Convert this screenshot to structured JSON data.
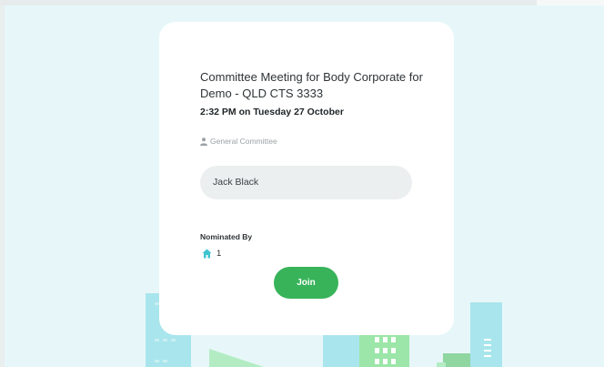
{
  "meeting": {
    "title": "Committee Meeting for Body Corporate for Demo - QLD CTS 3333",
    "datetime": "2:32 PM on Tuesday 27 October",
    "committee": "General Committee",
    "committee_icon": "user-icon"
  },
  "candidate": {
    "name": "Jack Black"
  },
  "nomination": {
    "label": "Nominated By",
    "icon": "home-icon",
    "count": "1"
  },
  "actions": {
    "join_label": "Join"
  },
  "colors": {
    "background": "#e7f7f9",
    "card": "#ffffff",
    "accent_green": "#38b35a",
    "home_teal": "#3fc3cf"
  }
}
